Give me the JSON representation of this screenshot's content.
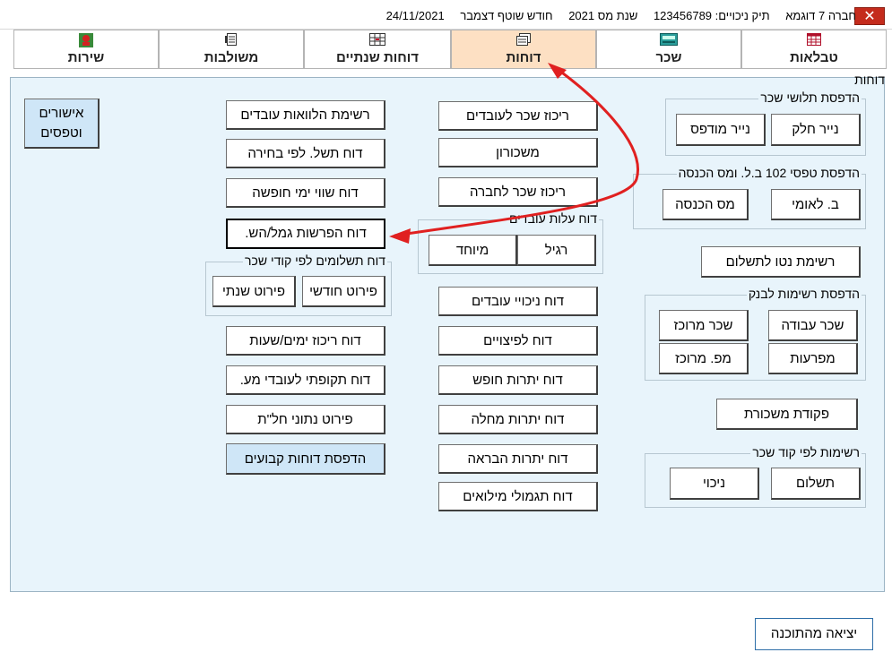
{
  "titlebar": {
    "company": "חברה 7 דוגמא",
    "file": "תיק ניכויים: 123456789",
    "tax_year": "שנת מס 2021",
    "month": "חודש שוטף דצמבר",
    "date": "24/11/2021",
    "close_glyph": "✕"
  },
  "tabs": [
    {
      "label": "טבלאות",
      "icon": "table-icon"
    },
    {
      "label": "שכר",
      "icon": "keyboard-icon"
    },
    {
      "label": "דוחות",
      "icon": "report-icon",
      "active": true
    },
    {
      "label": "דוחות שנתיים",
      "icon": "calendar-icon"
    },
    {
      "label": "משולבות",
      "icon": "document-icon"
    },
    {
      "label": "שירות",
      "icon": "service-icon"
    }
  ],
  "panel": {
    "title": "דוחות"
  },
  "groups": {
    "third_slips": {
      "title": "הדפסת תלושי שכר",
      "split_paper": "נייר חלק",
      "printed_paper": "נייר מודפס"
    },
    "forms102": {
      "title": "הדפסת טפסי 102 ב.ל. ומס הכנסה",
      "bl": "ב. לאומי",
      "income_tax": "מס הכנסה"
    },
    "net_list": "רשימת נטו לתשלום",
    "bank_lists": {
      "title": "הדפסת רשימות לבנק",
      "work_salary": "שכר עבודה",
      "central_salary": "שכר מרוכז",
      "deductions": "מפרעות",
      "central_mp": "מפ. מרוכז"
    },
    "payroll_order": "פקודת משכורת",
    "code_lists": {
      "title": "רשימות לפי קוד שכר",
      "payment": "תשלום",
      "deduction": "ניכוי"
    },
    "employee_cost": {
      "title": "דוח עלות עובדים",
      "regular": "רגיל",
      "special": "מיוחד"
    },
    "payments_by_code": {
      "title": "דוח תשלומים לפי קודי שכר",
      "monthly": "פירוט חודשי",
      "yearly": "פירוט שנתי"
    }
  },
  "middle_buttons": {
    "salary_summary": "ריכוז שכר לעובדים",
    "payslip": "משכורון",
    "company_summary": "ריכוז שכר לחברה",
    "deductions_report": "דוח ניכויי עובדים",
    "severance": "דוח לפיצויים",
    "vacation_balance": "דוח יתרות חופש",
    "sick_balance": "דוח יתרות מחלה",
    "recovery_balance": "דוח יתרות הבראה",
    "reserve": "דוח תגמולי מילואים"
  },
  "left_buttons": {
    "loans": "רשימת הלוואות עובדים",
    "pay_by_choice": "דוח תשל. לפי בחירה",
    "vacation_value": "דוח שווי ימי חופשה",
    "pension": "דוח הפרשות גמל/הש.",
    "days_hours": "דוח ריכוז ימים/שעות",
    "periodic": "דוח תקופתי לעובדי מע.",
    "abroad": "פירוט נתוני חל\"ת",
    "fixed_reports": "הדפסת דוחות קבועים"
  },
  "approvals": {
    "line1": "אישורים",
    "line2": "וטפסים"
  },
  "exit_label": "יציאה מהתוכנה",
  "colors": {
    "active_tab": "#fde0c3",
    "panel_bg": "#e8f4fb",
    "arrow": "#e02020",
    "highlight_btn": "#cfe6f7"
  }
}
